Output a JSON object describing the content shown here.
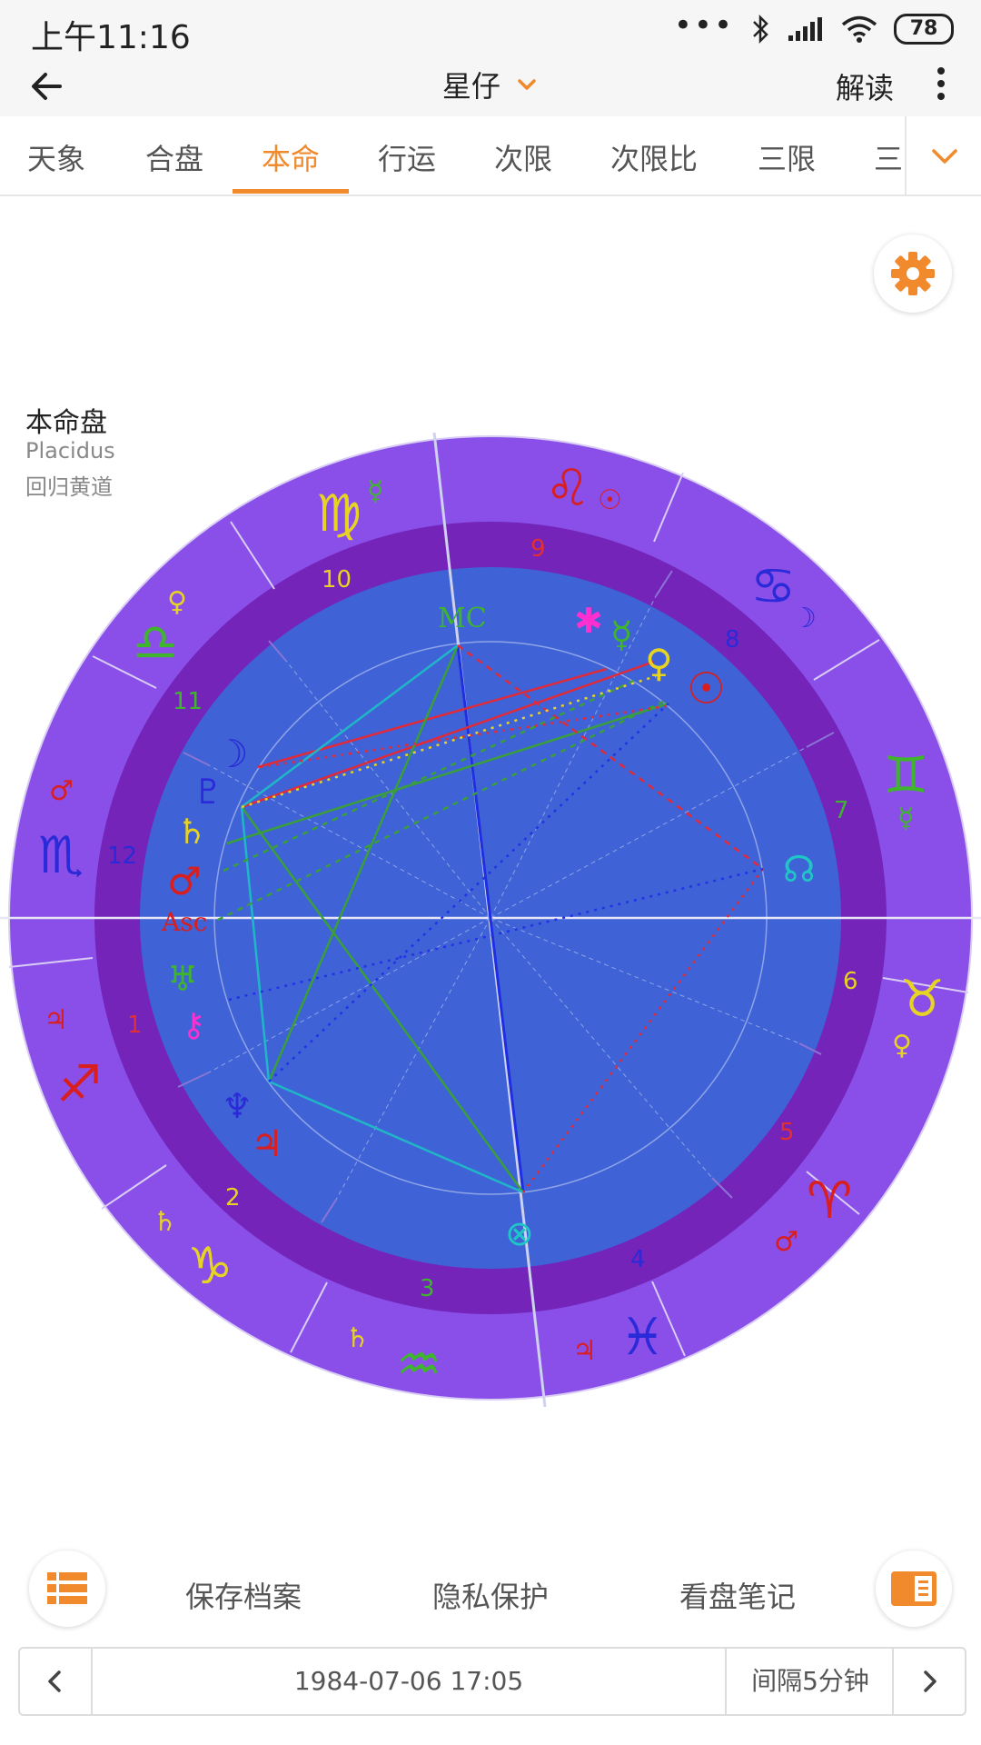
{
  "status_bar": {
    "time": "上午11:16",
    "battery": "78"
  },
  "app_bar": {
    "title": "星仔",
    "action": "解读"
  },
  "tabs": [
    "天象",
    "合盘",
    "本命",
    "行运",
    "次限",
    "次限比",
    "三限",
    "三"
  ],
  "active_tab": "本命",
  "chart_info": {
    "title": "本命盘",
    "house_system": "Placidus",
    "zodiac": "回归黄道"
  },
  "houses": [
    "1",
    "2",
    "3",
    "4",
    "5",
    "6",
    "7",
    "8",
    "9",
    "10",
    "11",
    "12"
  ],
  "angles": {
    "asc": "Asc",
    "mc": "MC"
  },
  "zodiac_signs": [
    {
      "name": "aries-sign-icon",
      "glyph": "♈",
      "color": "#d81e1e"
    },
    {
      "name": "taurus-sign-icon",
      "glyph": "♉",
      "color": "#e6d324"
    },
    {
      "name": "gemini-sign-icon",
      "glyph": "♊",
      "color": "#3fb52e"
    },
    {
      "name": "cancer-sign-icon",
      "glyph": "♋",
      "color": "#2a2ad8"
    },
    {
      "name": "leo-sign-icon",
      "glyph": "♌",
      "color": "#d81e1e"
    },
    {
      "name": "virgo-sign-icon",
      "glyph": "♍",
      "color": "#e6d324"
    },
    {
      "name": "libra-sign-icon",
      "glyph": "♎",
      "color": "#3fb52e"
    },
    {
      "name": "scorpio-sign-icon",
      "glyph": "♏",
      "color": "#2a2ad8"
    },
    {
      "name": "sagittarius-sign-icon",
      "glyph": "♐",
      "color": "#d81e1e"
    },
    {
      "name": "capricorn-sign-icon",
      "glyph": "♑",
      "color": "#e6d324"
    },
    {
      "name": "aquarius-sign-icon",
      "glyph": "♒",
      "color": "#3fb52e"
    },
    {
      "name": "pisces-sign-icon",
      "glyph": "♓",
      "color": "#2a2ad8"
    }
  ],
  "planets": [
    {
      "name": "sun-icon",
      "glyph": "☉",
      "color": "#d81e1e"
    },
    {
      "name": "venus-icon",
      "glyph": "♀",
      "color": "#e6d324"
    },
    {
      "name": "mercury-icon",
      "glyph": "☿",
      "color": "#3fb52e"
    },
    {
      "name": "juno-icon",
      "glyph": "✱",
      "color": "#ff2fd0"
    },
    {
      "name": "moon-icon",
      "glyph": "☽",
      "color": "#2a2ad8"
    },
    {
      "name": "pluto-icon",
      "glyph": "♇",
      "color": "#2a2ad8"
    },
    {
      "name": "saturn-icon",
      "glyph": "♄",
      "color": "#e6d324"
    },
    {
      "name": "mars-icon",
      "glyph": "♂",
      "color": "#d81e1e"
    },
    {
      "name": "uranus-icon",
      "glyph": "♅",
      "color": "#3fb52e"
    },
    {
      "name": "chiron-icon",
      "glyph": "⚷",
      "color": "#ff2fd0"
    },
    {
      "name": "neptune-icon",
      "glyph": "♆",
      "color": "#2a2ad8"
    },
    {
      "name": "jupiter-icon",
      "glyph": "♃",
      "color": "#d81e1e"
    },
    {
      "name": "part-of-fortune-icon",
      "glyph": "⊗",
      "color": "#20c6c6"
    },
    {
      "name": "north-node-icon",
      "glyph": "☊",
      "color": "#20c6c6"
    }
  ],
  "bottom_actions": {
    "save": "保存档案",
    "privacy": "隐私保护",
    "notes": "看盘笔记"
  },
  "date_bar": {
    "datetime": "1984-07-06 17:05",
    "interval": "间隔5分钟"
  },
  "colors": {
    "accent": "#f08a2c",
    "outer_ring": "#8a4fe8",
    "house_ring": "#7424b8",
    "inner_disc": "#3f63d6"
  }
}
